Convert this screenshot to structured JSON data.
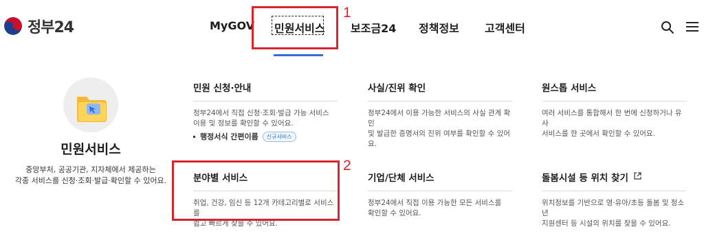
{
  "logo": {
    "text": "정부24"
  },
  "nav": {
    "items": [
      {
        "label": "MyGOV"
      },
      {
        "label": "민원서비스"
      },
      {
        "label": "보조금24"
      },
      {
        "label": "정책정보"
      },
      {
        "label": "고객센터"
      }
    ],
    "active_index": 1
  },
  "header_icons": [
    "search-icon",
    "menu-icon"
  ],
  "annotations": {
    "first": "1",
    "second": "2"
  },
  "hero": {
    "title": "민원서비스",
    "desc_line1": "중앙부처, 공공기관, 지자체에서 제공하는",
    "desc_line2": "각종 서비스를 신청·조회·발급·확인할 수 있어요."
  },
  "cards": [
    {
      "title": "민원 신청·안내",
      "desc_line1": "정부24에서 직접 신청·조회·발급 가능 서비스",
      "desc_line2": "이용 및 정보를 확인할 수 있어요."
    },
    {
      "title": "사실/진위 확인",
      "desc_line1": "정부24에서 이용 가능한 서비스의 사실 관계 확인",
      "desc_line2": "및 발급한 증명서의 진위 여부를 확인할 수 있어요."
    },
    {
      "title": "원스톱 서비스",
      "desc_line1": "여러 서비스를 통합해서 한 번에 신청하거나 유사",
      "desc_line2": "서비스를 한 곳에서 확인할 수 있어요."
    },
    {
      "title": "분야별 서비스",
      "desc_line1": "취업, 건강, 임신 등 12개 카테고리별로 서비스를",
      "desc_line2": "쉽고 빠르게 찾을 수 있어요."
    },
    {
      "title": "기업/단체 서비스",
      "desc_line1": "정부24에서 직접 이용 가능한 모든 서비스를",
      "desc_line2": "확인할 수 있어요."
    },
    {
      "title": "돌봄시설 등 위치 찾기",
      "desc_line1": "위치정보를 기반으로 영·유아/초등 돌봄 및 청소년",
      "desc_line2": "지원센터 등 시설의 위치를 찾을 수 있어요."
    }
  ],
  "sub_item": {
    "label": "행정서식 간편이름",
    "badge": "신규서비스"
  },
  "colors": {
    "accent": "#2f6fd6",
    "annotation": "#d8252c"
  }
}
